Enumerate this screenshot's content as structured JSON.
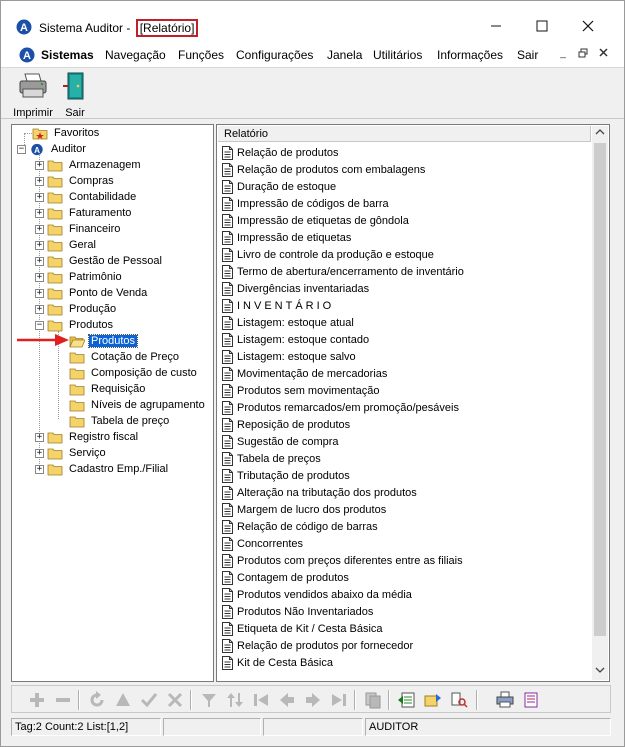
{
  "window": {
    "title": "Sistema Auditor - ",
    "title_highlight": "[Relatório]",
    "controls": [
      "minimize",
      "maximize",
      "close"
    ]
  },
  "menu": {
    "items": [
      "Sistemas",
      "Navegação",
      "Funções",
      "Configurações",
      "Janela",
      "Utilitários",
      "Informações",
      "Sair"
    ]
  },
  "toolbar": {
    "print_label": "Imprimir",
    "exit_label": "Sair"
  },
  "tree": {
    "favorites": "Favoritos",
    "root": "Auditor",
    "nodes": [
      "Armazenagem",
      "Compras",
      "Contabilidade",
      "Faturamento",
      "Financeiro",
      "Geral",
      "Gestão de Pessoal",
      "Patrimônio",
      "Ponto de Venda",
      "Produção",
      "Produtos"
    ],
    "produtos_children": [
      "Produtos",
      "Cotação de Preço",
      "Composição de custo",
      "Requisição",
      "Níveis de agrupamento",
      "Tabela de preço"
    ],
    "after_nodes": [
      "Registro fiscal",
      "Serviço",
      "Cadastro Emp./Filial"
    ],
    "selected": "Produtos"
  },
  "report": {
    "header": "Relatório",
    "items": [
      "Relação de produtos",
      "Relação de produtos com embalagens",
      "Duração de estoque",
      "Impressão de códigos de barra",
      "Impressão de etiquetas de gôndola",
      "Impressão de etiquetas",
      "Livro de controle da produção e estoque",
      "Termo de abertura/encerramento de inventário",
      "Divergências inventariadas",
      "INVENTÁRIO",
      "Listagem: estoque atual",
      "Listagem: estoque contado",
      "Listagem: estoque salvo",
      "Movimentação de mercadorias",
      "Produtos sem movimentação",
      "Produtos remarcados/em promoção/pesáveis",
      "Reposição de produtos",
      "Sugestão de compra",
      "Tabela de preços",
      "Tributação de produtos",
      "Alteração na tributação dos produtos",
      "Margem de lucro dos produtos",
      "Relação de código de barras",
      "Concorrentes",
      "Produtos com preços diferentes entre as filiais",
      "Contagem de produtos",
      "Produtos vendidos abaixo da média",
      "Produtos Não Inventariados",
      "Etiqueta de Kit / Cesta Básica",
      "Relação de produtos por fornecedor",
      "Kit de Cesta Básica"
    ]
  },
  "status": {
    "tag_info": "Tag:2 Count:2 List:[1,2]",
    "user": "AUDITOR"
  },
  "colors": {
    "selection": "#0a64d8",
    "highlight_border": "#c0202a",
    "folder": "#f4d46a"
  }
}
